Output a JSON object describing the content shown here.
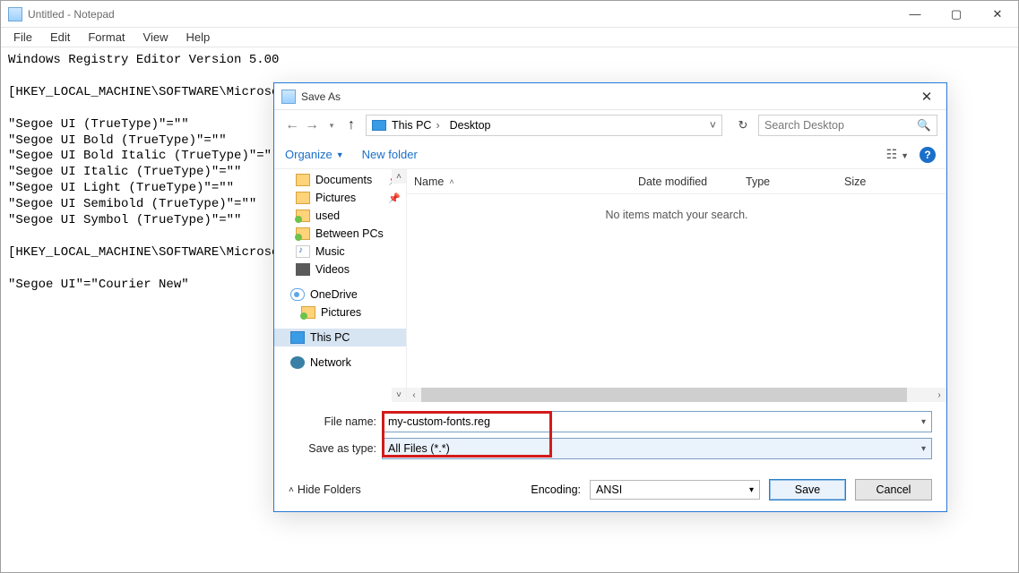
{
  "notepad": {
    "title": "Untitled - Notepad",
    "menu": {
      "file": "File",
      "edit": "Edit",
      "format": "Format",
      "view": "View",
      "help": "Help"
    },
    "content": "Windows Registry Editor Version 5.00\n\n[HKEY_LOCAL_MACHINE\\SOFTWARE\\Microsof\n\n\"Segoe UI (TrueType)\"=\"\"\n\"Segoe UI Bold (TrueType)\"=\"\"\n\"Segoe UI Bold Italic (TrueType)\"=\"\"\n\"Segoe UI Italic (TrueType)\"=\"\"\n\"Segoe UI Light (TrueType)\"=\"\"\n\"Segoe UI Semibold (TrueType)\"=\"\"\n\"Segoe UI Symbol (TrueType)\"=\"\"\n\n[HKEY_LOCAL_MACHINE\\SOFTWARE\\Microsof\n\n\"Segoe UI\"=\"Courier New\""
  },
  "dialog": {
    "title": "Save As",
    "breadcrumb": {
      "root_icon": "pc-icon",
      "item1": "This PC",
      "item2": "Desktop"
    },
    "search_placeholder": "Search Desktop",
    "organize": "Organize",
    "new_folder": "New folder",
    "columns": {
      "name": "Name",
      "date": "Date modified",
      "type": "Type",
      "size": "Size"
    },
    "empty_msg": "No items match your search.",
    "sidebar": {
      "items": [
        {
          "label": "Documents",
          "icon": "folder"
        },
        {
          "label": "Pictures",
          "icon": "folder"
        },
        {
          "label": "used",
          "icon": "folder-g"
        },
        {
          "label": "Between PCs",
          "icon": "folder-g"
        },
        {
          "label": "Music",
          "icon": "music"
        },
        {
          "label": "Videos",
          "icon": "video"
        }
      ],
      "onedrive": "OneDrive",
      "onedrive_child": "Pictures",
      "thispc": "This PC",
      "network": "Network"
    },
    "file_name_label": "File name:",
    "file_name_value": "my-custom-fonts.reg",
    "save_type_label": "Save as type:",
    "save_type_value": "All Files  (*.*)",
    "hide_folders": "Hide Folders",
    "encoding_label": "Encoding:",
    "encoding_value": "ANSI",
    "save": "Save",
    "cancel": "Cancel"
  }
}
